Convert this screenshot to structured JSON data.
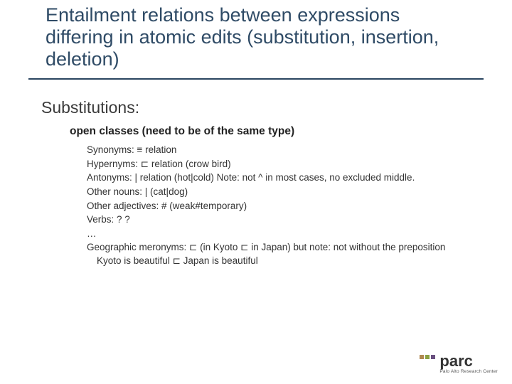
{
  "title": "Entailment relations between expressions differing in atomic edits (substitution, insertion, deletion)",
  "section": "Substitutions:",
  "subhead": "open classes (need to be of the same type)",
  "bullets": [
    "Synonyms: ≡ relation",
    "Hypernyms: ⊏ relation (crow  bird)",
    "Antonyms: | relation (hot|cold)  Note: not ^ in most cases, no excluded middle.",
    "Other nouns: | (cat|dog)",
    "Other adjectives: # (weak#temporary)",
    "Verbs: ? ?",
    "…",
    "Geographic meronyms: ⊏ (in Kyoto ⊏ in Japan) but note: not without the preposition Kyoto is beautiful ⊏ Japan is beautiful"
  ],
  "logo": {
    "word": "parc",
    "sub": "Palo Alto Research Center"
  }
}
